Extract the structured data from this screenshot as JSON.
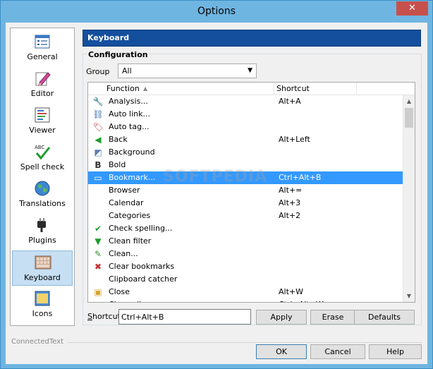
{
  "window": {
    "title": "Options",
    "close_glyph": "✕"
  },
  "sidebar": {
    "items": [
      {
        "label": "General",
        "icon": "general-icon"
      },
      {
        "label": "Editor",
        "icon": "editor-icon"
      },
      {
        "label": "Viewer",
        "icon": "viewer-icon"
      },
      {
        "label": "Spell check",
        "icon": "spell-check-icon"
      },
      {
        "label": "Translations",
        "icon": "globe-icon"
      },
      {
        "label": "Plugins",
        "icon": "plug-icon"
      },
      {
        "label": "Keyboard",
        "icon": "keyboard-icon",
        "selected": true
      },
      {
        "label": "Icons",
        "icon": "icons-icon"
      }
    ]
  },
  "panel": {
    "title": "Keyboard",
    "configuration_title": "Configuration",
    "group_label": "Group",
    "group_value": "All"
  },
  "list": {
    "columns": {
      "function": "Function",
      "shortcut": "Shortcut"
    },
    "rows": [
      {
        "function": "Analysis...",
        "shortcut": "Alt+A",
        "icon": "analysis-icon"
      },
      {
        "function": "Auto link...",
        "shortcut": "",
        "icon": "link-icon"
      },
      {
        "function": "Auto tag...",
        "shortcut": "",
        "icon": "tag-icon"
      },
      {
        "function": "Back",
        "shortcut": "Alt+Left",
        "icon": "back-arrow-icon"
      },
      {
        "function": "Background",
        "shortcut": "",
        "icon": "background-icon"
      },
      {
        "function": "Bold",
        "shortcut": "",
        "icon": "bold-icon"
      },
      {
        "function": "Bookmark...",
        "shortcut": "Ctrl+Alt+B",
        "icon": "bookmark-icon",
        "selected": true
      },
      {
        "function": "Browser",
        "shortcut": "Alt+=",
        "icon": ""
      },
      {
        "function": "Calendar",
        "shortcut": "Alt+3",
        "icon": ""
      },
      {
        "function": "Categories",
        "shortcut": "Alt+2",
        "icon": ""
      },
      {
        "function": "Check spelling...",
        "shortcut": "",
        "icon": "spell-check-icon"
      },
      {
        "function": "Clean filter",
        "shortcut": "",
        "icon": "filter-icon"
      },
      {
        "function": "Clean...",
        "shortcut": "",
        "icon": "broom-icon"
      },
      {
        "function": "Clear bookmarks",
        "shortcut": "",
        "icon": "clear-bookmarks-icon"
      },
      {
        "function": "Clipboard catcher",
        "shortcut": "",
        "icon": ""
      },
      {
        "function": "Close",
        "shortcut": "Alt+W",
        "icon": "close-folder-icon"
      },
      {
        "function": "Close all",
        "shortcut": "Ctrl+Alt+W",
        "icon": ""
      }
    ]
  },
  "shortcut": {
    "label_u": "S",
    "label_rest": "hortcut",
    "value": "Ctrl+Alt+B"
  },
  "buttons": {
    "apply": "Apply",
    "erase": "Erase",
    "defaults": "Defaults",
    "ok": "OK",
    "cancel": "Cancel",
    "help": "Help"
  },
  "footer": {
    "brand": "ConnectedText"
  },
  "watermark": "SOFTPEDIA"
}
